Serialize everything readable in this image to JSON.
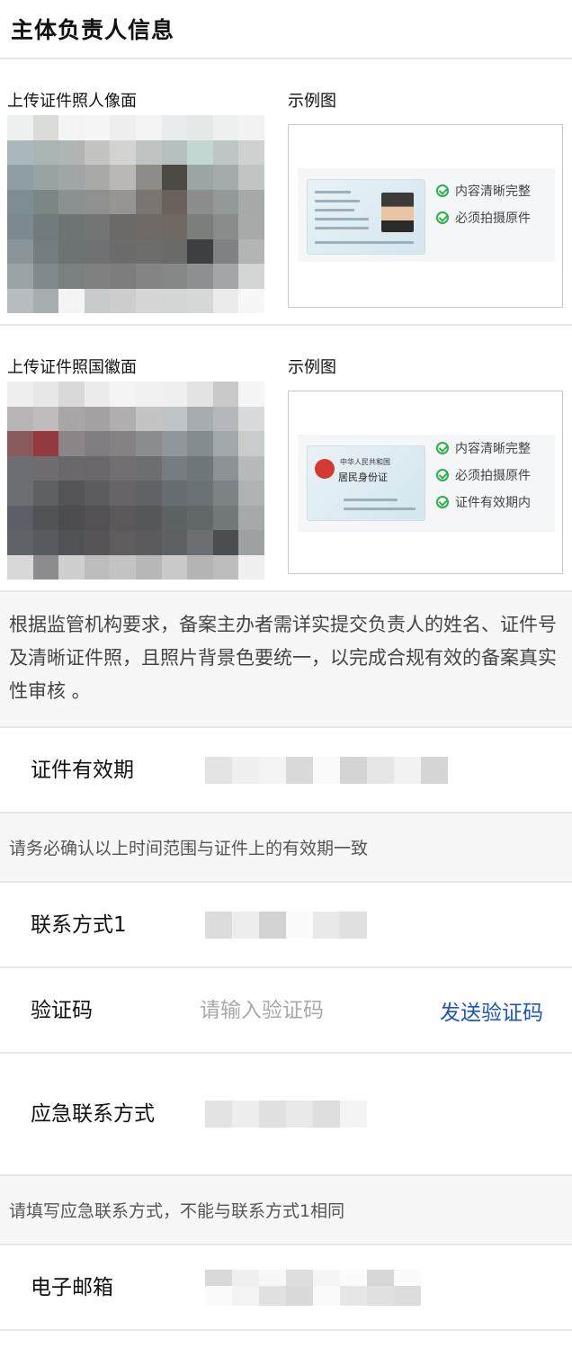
{
  "header": {
    "title": "主体负责人信息"
  },
  "upload_portrait": {
    "label": "上传证件照人像面",
    "example_label": "示例图",
    "checks": [
      "内容清晰完整",
      "必须拍摄原件"
    ]
  },
  "upload_emblem": {
    "label": "上传证件照国徽面",
    "example_label": "示例图",
    "checks": [
      "内容清晰完整",
      "必须拍摄原件",
      "证件有效期内"
    ],
    "card_title": "中华人民共和国",
    "card_subtitle": "居民身份证"
  },
  "notice": {
    "text": "根据监管机构要求，备案主办者需详实提交负责人的姓名、证件号及清晰证件照，且照片背景色要统一，以完成合规有效的备案真实性审核 。"
  },
  "fields": {
    "id_validity": {
      "label": "证件有效期"
    },
    "id_validity_hint": "请务必确认以上时间范围与证件上的有效期一致",
    "contact1": {
      "label": "联系方式1"
    },
    "verify_code": {
      "label": "验证码",
      "placeholder": "请输入验证码",
      "send_label": "发送验证码"
    },
    "emergency": {
      "label": "应急联系方式"
    },
    "emergency_hint": "请填写应急联系方式，不能与联系方式1相同",
    "email": {
      "label": "电子邮箱"
    }
  },
  "colors": {
    "accent": "#1a55c0",
    "check_green": "#2bb24c"
  }
}
